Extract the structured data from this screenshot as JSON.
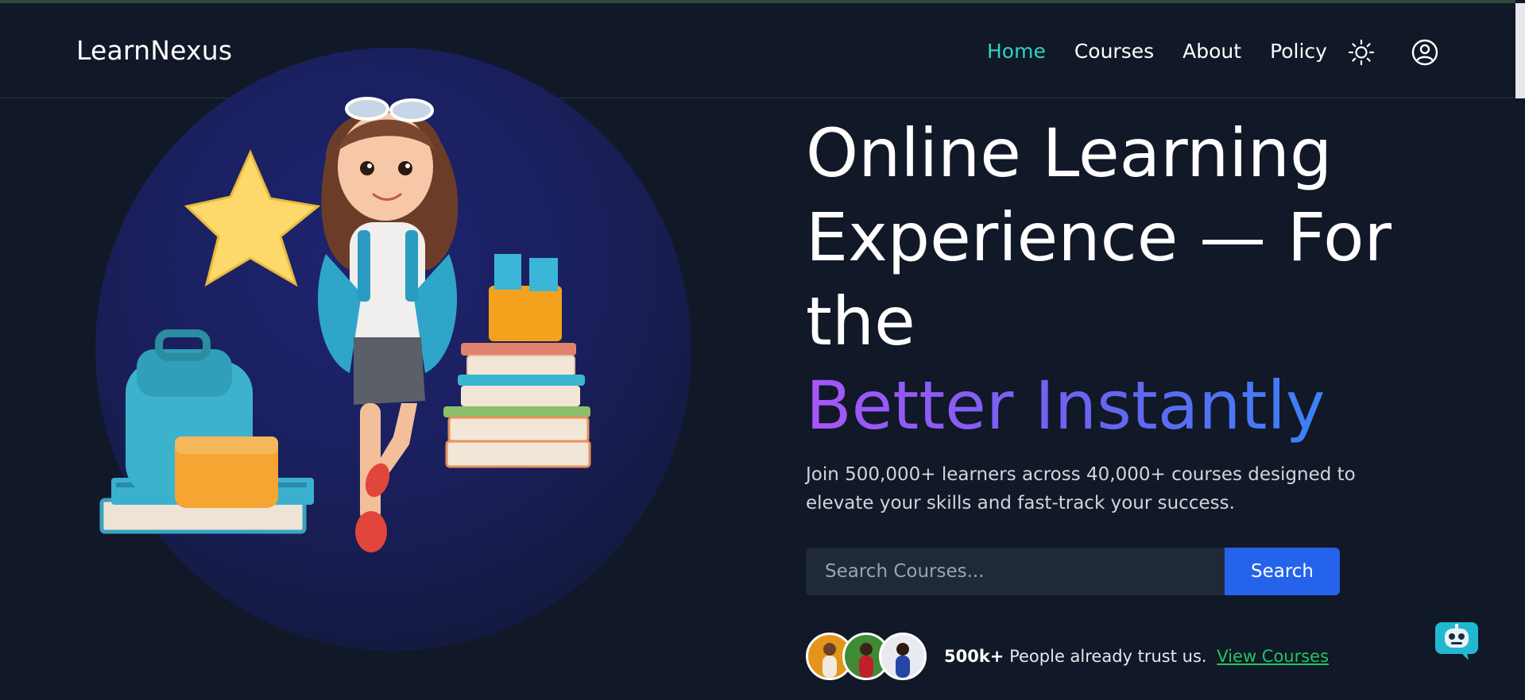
{
  "brand": {
    "name": "LearnNexus"
  },
  "nav": {
    "items": [
      {
        "label": "Home",
        "active": true
      },
      {
        "label": "Courses",
        "active": false
      },
      {
        "label": "About",
        "active": false
      },
      {
        "label": "Policy",
        "active": false
      }
    ],
    "theme_icon": "sun-icon",
    "account_icon": "user-circle-icon"
  },
  "hero": {
    "title_lines": [
      "Online Learning",
      "Experience — For",
      "the"
    ],
    "title_accent": "Better Instantly",
    "subtitle": "Join 500,000+ learners across 40,000+ courses designed to elevate your skills and fast-track your success.",
    "search": {
      "placeholder": "Search Courses...",
      "value": "",
      "button_label": "Search"
    },
    "trust": {
      "count": "500k+",
      "text": "People already trust us.",
      "link_label": "View Courses"
    }
  },
  "colors": {
    "background": "#111827",
    "active_link": "#2dd4bf",
    "accent_gradient": [
      "#a855f7",
      "#6366f1",
      "#3b82f6"
    ],
    "search_button": "#2563eb",
    "link_green": "#22c55e"
  },
  "chat_widget": {
    "icon": "chatbot-icon"
  }
}
